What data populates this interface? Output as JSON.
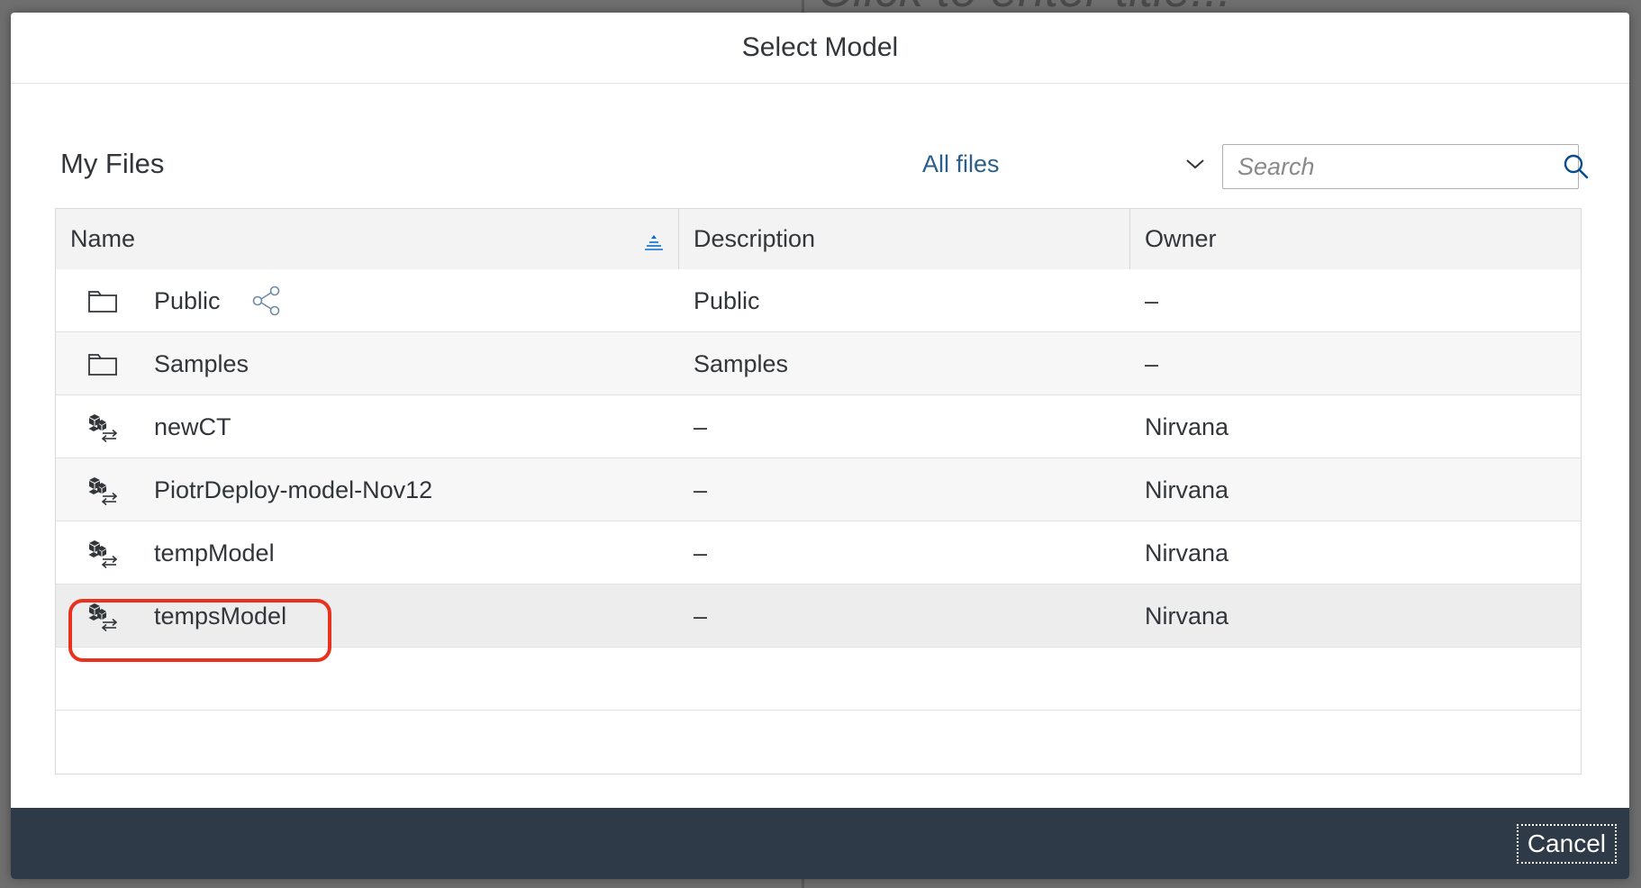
{
  "background": {
    "title": "Click to enter title..."
  },
  "dialog": {
    "title": "Select Model"
  },
  "toolbar": {
    "section_title": "My Files",
    "filter_label": "All files",
    "search_placeholder": "Search"
  },
  "table": {
    "columns": [
      "Name",
      "Description",
      "Owner"
    ],
    "rows": [
      {
        "icon": "folder-icon",
        "name": "Public",
        "description": "Public",
        "owner": "–",
        "shared": true
      },
      {
        "icon": "folder-icon",
        "name": "Samples",
        "description": "Samples",
        "owner": "–",
        "shared": false
      },
      {
        "icon": "model-icon",
        "name": "newCT",
        "description": "–",
        "owner": "Nirvana",
        "shared": false
      },
      {
        "icon": "model-icon",
        "name": "PiotrDeploy-model-Nov12",
        "description": "–",
        "owner": "Nirvana",
        "shared": false
      },
      {
        "icon": "model-icon",
        "name": "tempModel",
        "description": "–",
        "owner": "Nirvana",
        "shared": false
      },
      {
        "icon": "model-icon",
        "name": "tempsModel",
        "description": "–",
        "owner": "Nirvana",
        "shared": false
      }
    ]
  },
  "footer": {
    "cancel_label": "Cancel"
  },
  "colors": {
    "footer_bg": "#2e3a47",
    "highlight": "#e8321e",
    "link": "#2b5f8a"
  }
}
